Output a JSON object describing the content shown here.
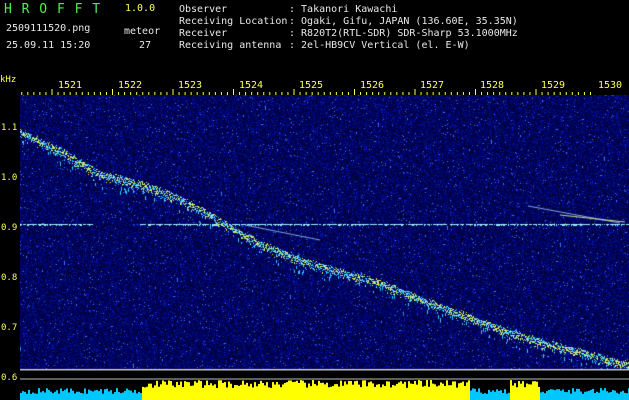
{
  "app": {
    "title": "H R O F F T",
    "version": "1.0.0",
    "filename": "2509111520.png",
    "datetime": "25.09.11 15:20",
    "count_label": "meteor",
    "count_value": "27"
  },
  "info": {
    "rows": [
      {
        "label": "Observer",
        "value": ": Takanori Kawachi"
      },
      {
        "label": "Receiving Location",
        "value": ": Ogaki, Gifu, JAPAN (136.60E, 35.35N)"
      },
      {
        "label": "Receiver",
        "value": ": R820T2(RTL-SDR) SDR-Sharp 53.1000MHz"
      },
      {
        "label": "Receiving antenna",
        "value": ": 2el-HB9CV Vertical (el. E-W)"
      }
    ]
  },
  "axes": {
    "y_unit": "kHz",
    "x_ticks": [
      "1521",
      "1522",
      "1523",
      "1524",
      "1525",
      "1526",
      "1527",
      "1528",
      "1529",
      "1530"
    ],
    "y_ticks": [
      "1.1",
      "1.0",
      "0.9",
      "0.8",
      "0.7",
      "0.6"
    ]
  },
  "colors": {
    "background": "#000000",
    "spectrogram_base": "#000a6e",
    "trace": "#d8f070",
    "trace_edge": "#30c8ff",
    "carrier": "#9ef0ff",
    "meteor_bar": "#ffff00",
    "noise_bar": "#00c8ff",
    "text_green": "#4ff04f",
    "text_white": "#e8e8e8",
    "text_yellow": "#ffff55"
  }
}
